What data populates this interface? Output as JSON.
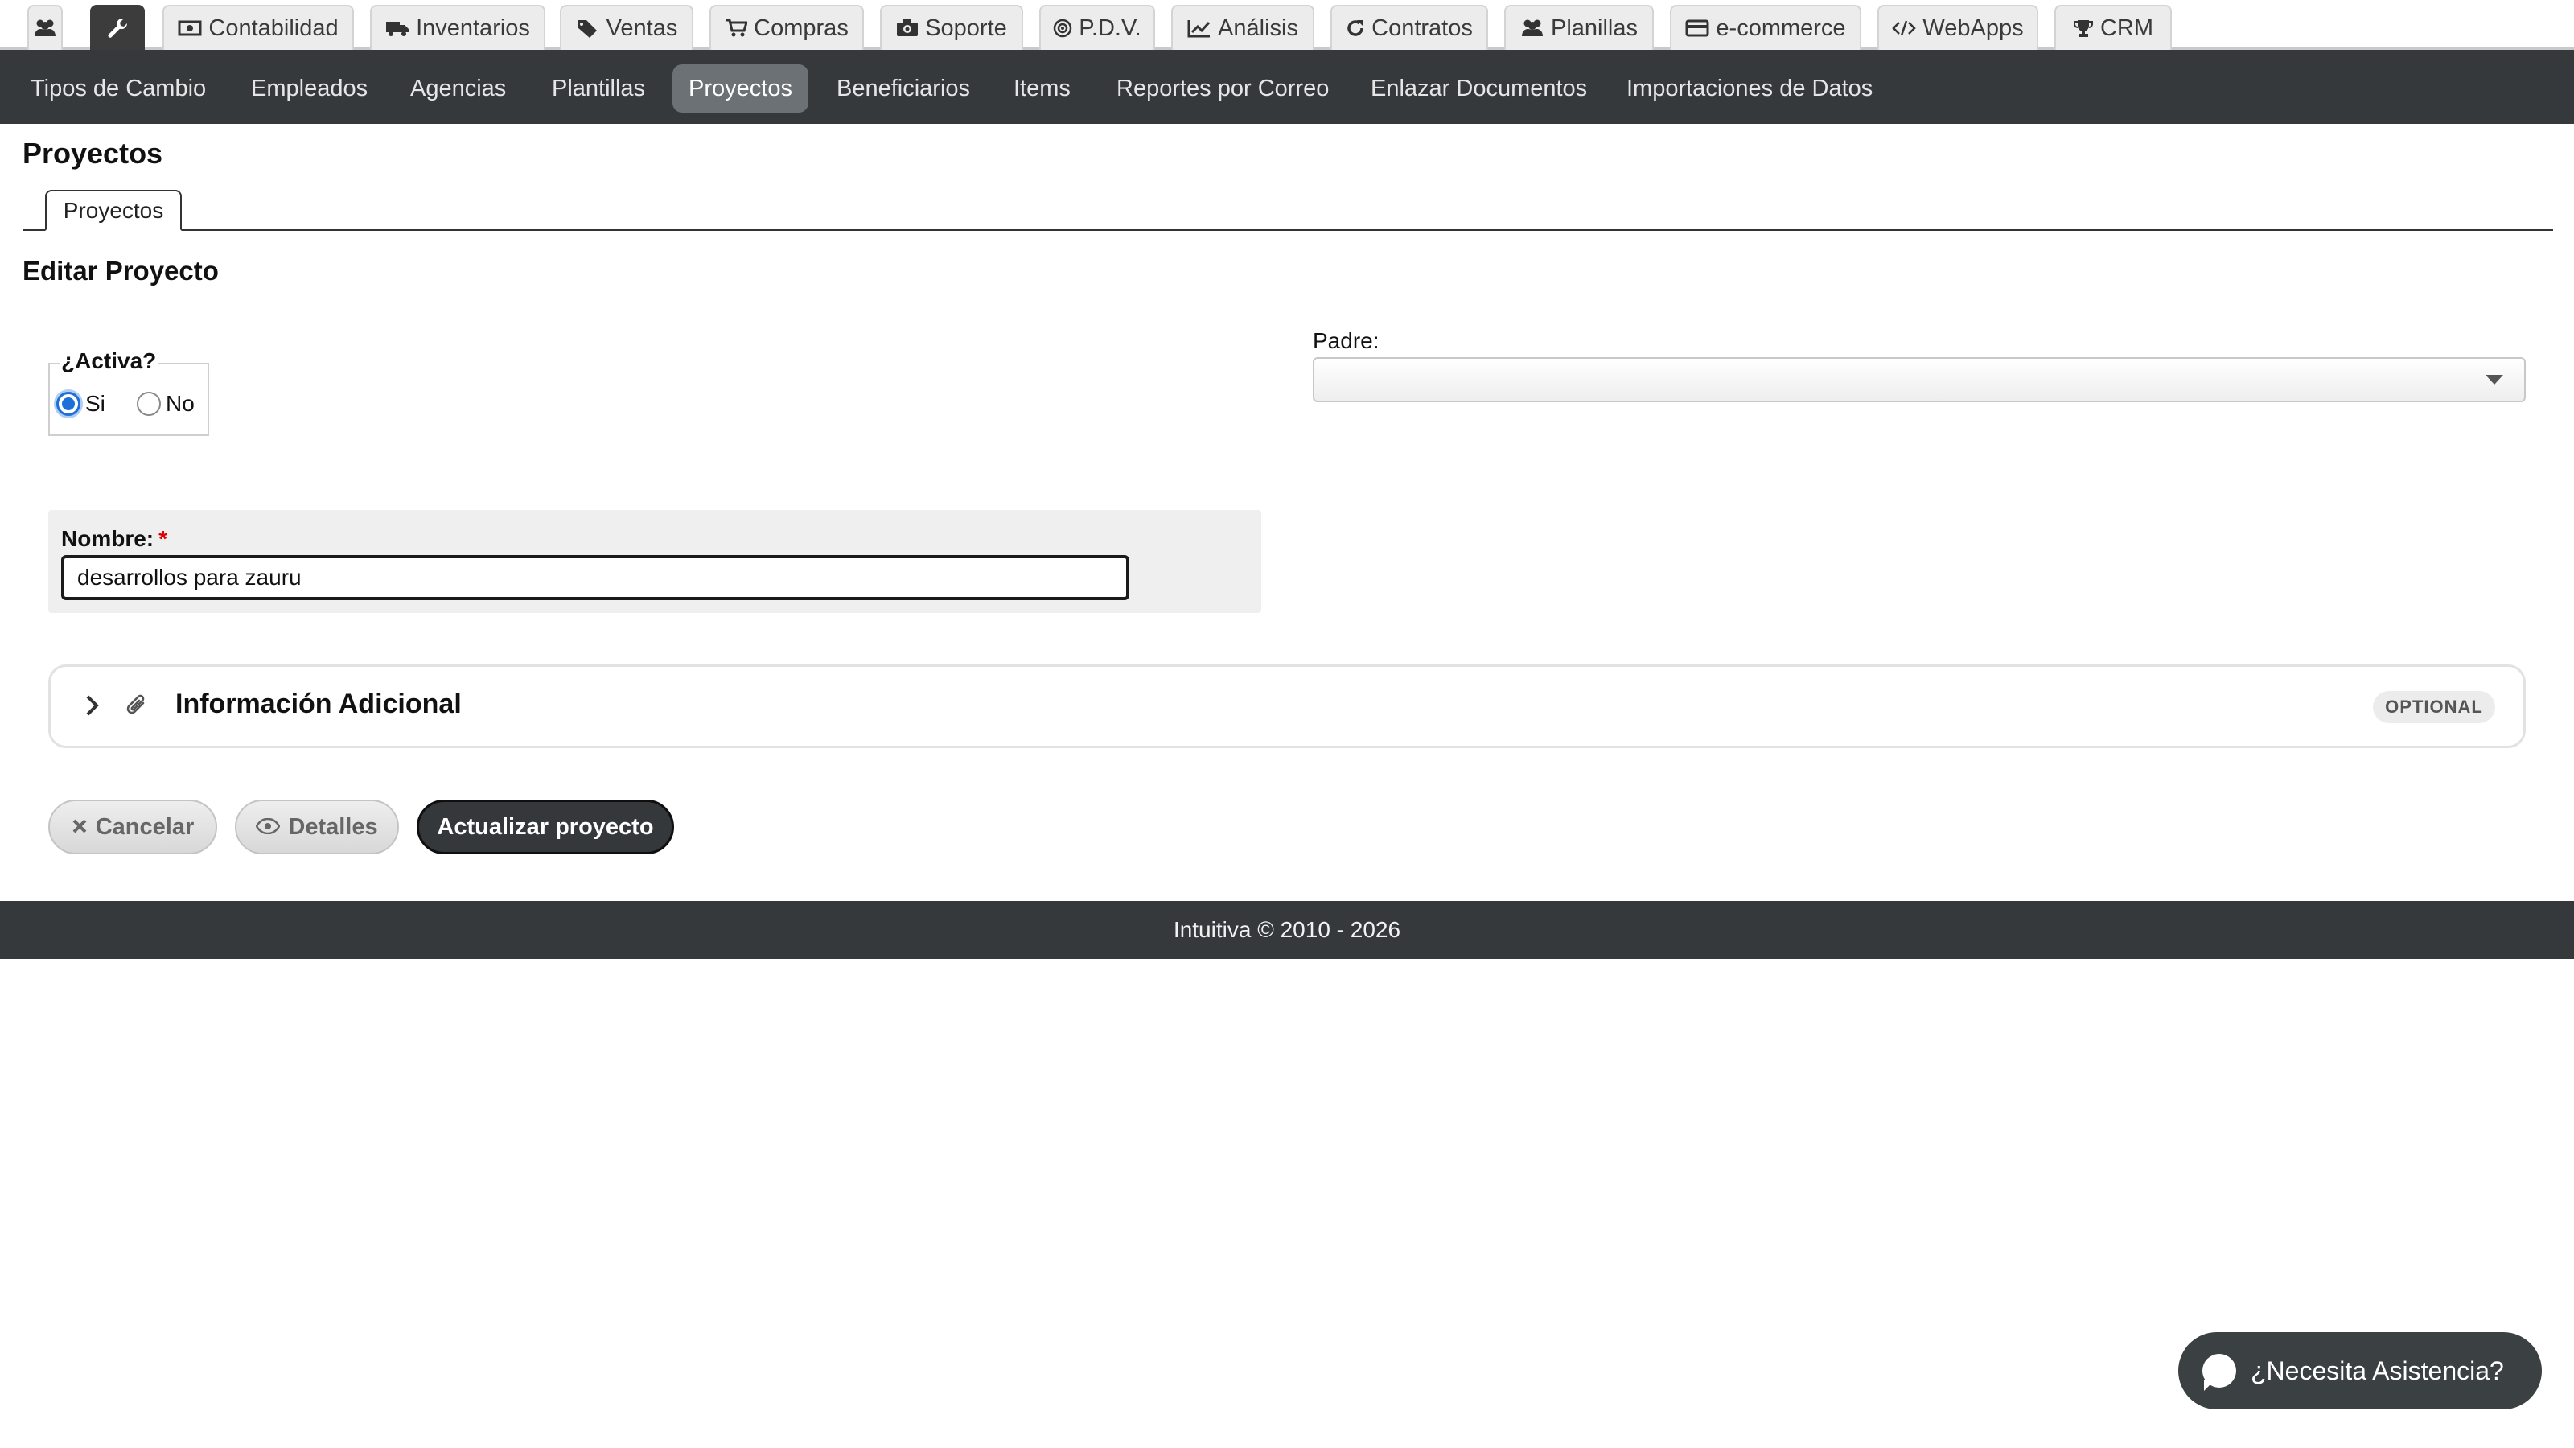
{
  "top_tabs": [
    {
      "icon": "users-icon",
      "label": ""
    },
    {
      "icon": "wrench-icon",
      "label": ""
    },
    {
      "icon": "money-icon",
      "label": "Contabilidad"
    },
    {
      "icon": "truck-icon",
      "label": "Inventarios"
    },
    {
      "icon": "tags-icon",
      "label": "Ventas"
    },
    {
      "icon": "cart-icon",
      "label": "Compras"
    },
    {
      "icon": "camera-icon",
      "label": "Soporte"
    },
    {
      "icon": "target-icon",
      "label": "P.D.V."
    },
    {
      "icon": "chart-icon",
      "label": "Análisis"
    },
    {
      "icon": "refresh-icon",
      "label": "Contratos"
    },
    {
      "icon": "users-icon",
      "label": "Planillas"
    },
    {
      "icon": "credit-card-icon",
      "label": "e-commerce"
    },
    {
      "icon": "code-icon",
      "label": "WebApps"
    },
    {
      "icon": "trophy-icon",
      "label": "CRM"
    }
  ],
  "subnav": [
    {
      "label": "Tipos de Cambio"
    },
    {
      "label": "Empleados"
    },
    {
      "label": "Agencias"
    },
    {
      "label": "Plantillas"
    },
    {
      "label": "Proyectos",
      "active": true
    },
    {
      "label": "Beneficiarios"
    },
    {
      "label": "Items"
    },
    {
      "label": "Reportes por Correo"
    },
    {
      "label": "Enlazar Documentos"
    },
    {
      "label": "Importaciones de Datos"
    }
  ],
  "page": {
    "title": "Proyectos",
    "tab": "Proyectos",
    "section_title": "Editar Proyecto"
  },
  "form": {
    "activa_legend": "¿Activa?",
    "activa_options": [
      "Si",
      "No"
    ],
    "activa_selected": "Si",
    "padre_label": "Padre:",
    "padre_value": "",
    "nombre_label": "Nombre:",
    "nombre_required_mark": "*",
    "nombre_value": "desarrollos para zauru"
  },
  "info_adicional": {
    "title": "Información Adicional",
    "badge": "OPTIONAL"
  },
  "buttons": {
    "cancel": "Cancelar",
    "details": "Detalles",
    "update": "Actualizar proyecto"
  },
  "footer": {
    "text": "Intuitiva © 2010 - 2026"
  },
  "help": {
    "label": "¿Necesita Asistencia?"
  },
  "colors": {
    "nav_dark": "#35393c",
    "active_subnav": "#6c7176",
    "radio_accent": "#1e6fd9",
    "required": "#dd0000"
  }
}
